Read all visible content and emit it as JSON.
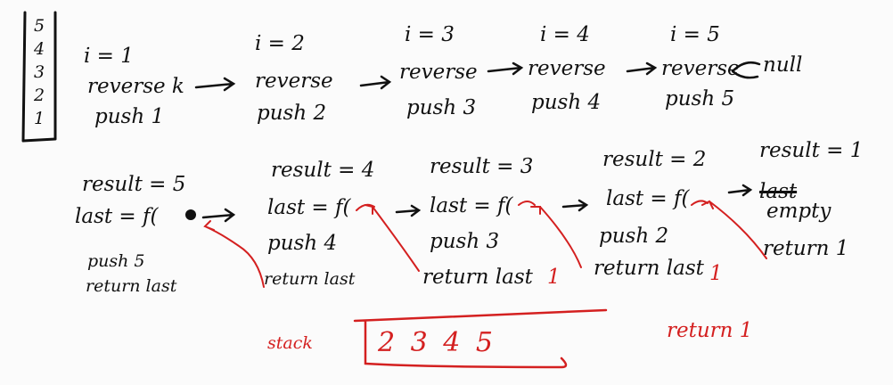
{
  "stack_sketch": [
    "5",
    "4",
    "3",
    "2",
    "1"
  ],
  "top_row": [
    {
      "i": "i = 1",
      "action": "reverse k",
      "push": "push 1"
    },
    {
      "i": "i = 2",
      "action": "reverse",
      "push": "push 2"
    },
    {
      "i": "i = 3",
      "action": "reverse",
      "push": "push 3"
    },
    {
      "i": "i = 4",
      "action": "reverse",
      "push": "push 4"
    },
    {
      "i": "i = 5",
      "action": "reverse",
      "push": "push 5"
    }
  ],
  "top_end": "null",
  "bottom_row": [
    {
      "result": "result = 5",
      "last": "last = f(",
      "push": "push 5",
      "ret": "return last"
    },
    {
      "result": "result = 4",
      "last": "last = f(",
      "push": "push 4",
      "ret": "return last"
    },
    {
      "result": "result = 3",
      "last": "last = f(",
      "push": "push 3",
      "ret": "return last"
    },
    {
      "result": "result = 2",
      "last": "last = f(",
      "push": "push 2",
      "ret": "return last"
    },
    {
      "result": "result = 1",
      "last": "last",
      "empty": "empty",
      "ret": "return 1"
    }
  ],
  "red_marks": {
    "one_a": "1",
    "one_b": "1",
    "stack_label": "stack",
    "stack_values": "2 3 4 5",
    "return_label": "return 1"
  },
  "colors": {
    "ink": "#111111",
    "red": "#d42020"
  }
}
